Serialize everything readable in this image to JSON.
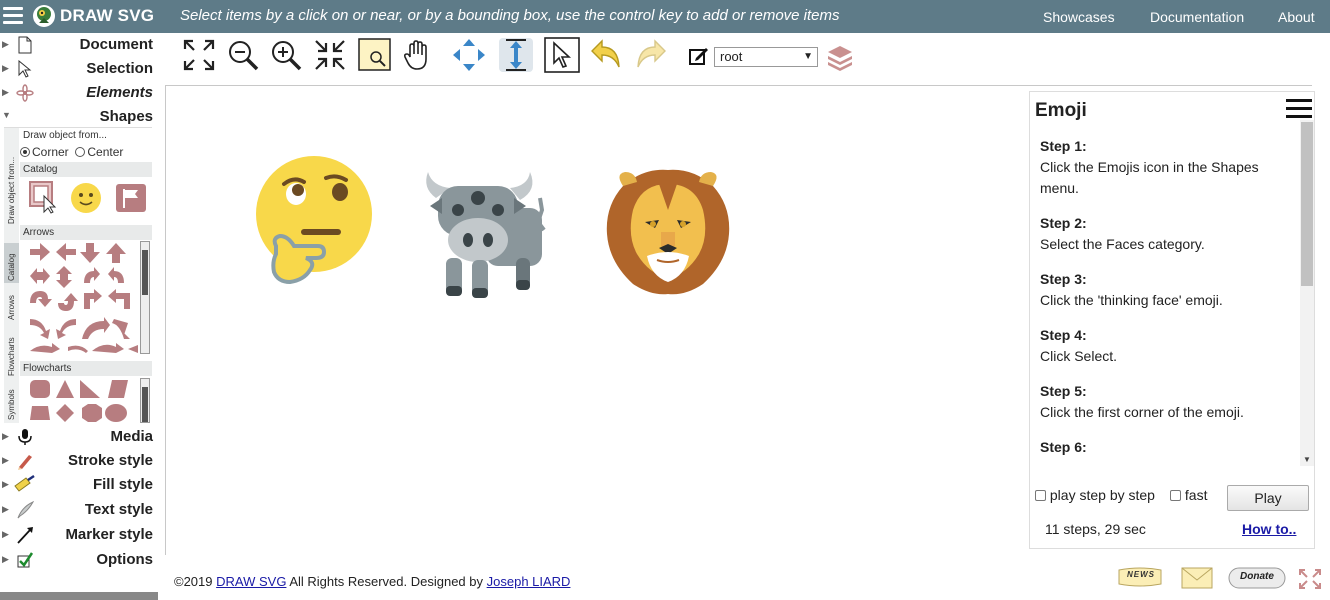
{
  "app": {
    "brand": "DRAW SVG",
    "hint": "Select items by a click on or near, or by a bounding box, use the control key to add or remove items",
    "nav": [
      "Showcases",
      "Documentation",
      "About"
    ]
  },
  "sidebar": {
    "items": [
      {
        "label": "Document",
        "icon": "document-icon"
      },
      {
        "label": "Selection",
        "icon": "cursor-icon"
      },
      {
        "label": "Elements",
        "icon": "flower-icon"
      },
      {
        "label": "Shapes",
        "icon": "none"
      },
      {
        "label": "Media",
        "icon": "microphone-icon"
      },
      {
        "label": "Stroke style",
        "icon": "pencil-icon"
      },
      {
        "label": "Fill style",
        "icon": "paint-roller-icon"
      },
      {
        "label": "Text style",
        "icon": "feather-pen-icon"
      },
      {
        "label": "Marker style",
        "icon": "arrow-marker-icon"
      },
      {
        "label": "Options",
        "icon": "checkbox-icon"
      }
    ],
    "shapes": {
      "vtabs": [
        "Draw object from...",
        "Catalog",
        "Arrows",
        "Flowcharts",
        "Symbols"
      ],
      "draw_from_label": "Draw object from...",
      "corner_label": "Corner",
      "center_label": "Center",
      "catalog_label": "Catalog",
      "arrows_label": "Arrows",
      "flowcharts_label": "Flowcharts"
    }
  },
  "toolbar": {
    "buttons": [
      "fit-page-icon",
      "zoom-out-icon",
      "zoom-in-icon",
      "fit-content-icon",
      "zoom-selection-icon",
      "pan-hand-icon",
      "move-icon",
      "resize-icon",
      "select-pointer-icon",
      "undo-icon",
      "redo-icon",
      "edit-icon",
      "layers-icon"
    ],
    "layer_select": "root"
  },
  "help": {
    "title": "Emoji",
    "steps": [
      {
        "head": "Step 1:",
        "text": "Click the Emojis icon in the Shapes menu."
      },
      {
        "head": "Step 2:",
        "text": "Select the Faces category."
      },
      {
        "head": "Step 3:",
        "text": "Click the 'thinking face' emoji."
      },
      {
        "head": "Step 4:",
        "text": "Click Select."
      },
      {
        "head": "Step 5:",
        "text": "Click the first corner of the emoji."
      },
      {
        "head": "Step 6:",
        "text": ""
      }
    ],
    "play_step_label": "play step by step",
    "fast_label": "fast",
    "play_button": "Play",
    "summary": "11 steps, 29 sec",
    "howto_link": "How to.."
  },
  "footer": {
    "copyright": "©2019",
    "site_link": "DRAW SVG",
    "rights": "All Rights Reserved. Designed by",
    "author_link": "Joseph LIARD",
    "badges": [
      "NEWS",
      "Donate"
    ]
  },
  "colors": {
    "topbar": "#5e7b88",
    "shape_fill": "#b77d80",
    "emoji_yellow": "#f8d84a",
    "bull_gray": "#8a969b",
    "lion_mane": "#b0652a"
  }
}
